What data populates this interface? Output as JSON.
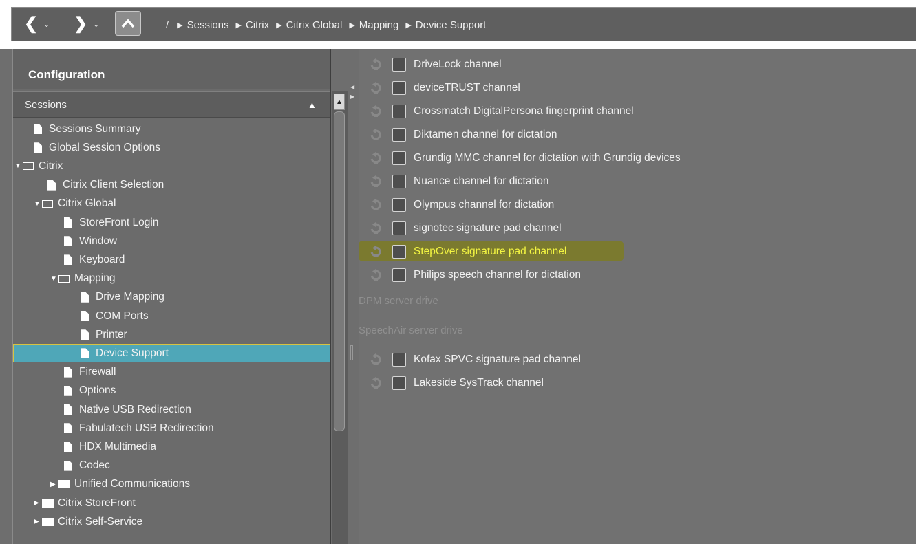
{
  "toolbar": {
    "back_icon": "chevron-left-icon",
    "forward_icon": "chevron-right-icon",
    "dropdown_icon": "caret-down-icon",
    "up_icon": "chevron-up-icon",
    "breadcrumb": {
      "root": "/",
      "items": [
        "Sessions",
        "Citrix",
        "Citrix Global",
        "Mapping",
        "Device Support"
      ]
    }
  },
  "sidebar": {
    "title": "Configuration",
    "section": "Sessions",
    "tree": [
      {
        "label": "Sessions Summary",
        "type": "file"
      },
      {
        "label": "Global Session Options",
        "type": "file"
      },
      {
        "label": "Citrix",
        "type": "folder-open"
      },
      {
        "label": "Citrix Client Selection",
        "type": "file"
      },
      {
        "label": "Citrix Global",
        "type": "folder-open"
      },
      {
        "label": "StoreFront Login",
        "type": "file"
      },
      {
        "label": "Window",
        "type": "file"
      },
      {
        "label": "Keyboard",
        "type": "file"
      },
      {
        "label": "Mapping",
        "type": "folder-open"
      },
      {
        "label": "Drive Mapping",
        "type": "file"
      },
      {
        "label": "COM Ports",
        "type": "file"
      },
      {
        "label": "Printer",
        "type": "file"
      },
      {
        "label": "Device Support",
        "type": "file",
        "selected": true
      },
      {
        "label": "Firewall",
        "type": "file"
      },
      {
        "label": "Options",
        "type": "file"
      },
      {
        "label": "Native USB Redirection",
        "type": "file"
      },
      {
        "label": "Fabulatech USB Redirection",
        "type": "file"
      },
      {
        "label": "HDX Multimedia",
        "type": "file"
      },
      {
        "label": "Codec",
        "type": "file"
      },
      {
        "label": "Unified Communications",
        "type": "folder-closed"
      },
      {
        "label": "Citrix StoreFront",
        "type": "folder-closed"
      },
      {
        "label": "Citrix Self-Service",
        "type": "folder-closed"
      }
    ]
  },
  "content": {
    "channels": [
      {
        "label": "DriveLock channel",
        "checked": false
      },
      {
        "label": "deviceTRUST channel",
        "checked": false
      },
      {
        "label": "Crossmatch DigitalPersona fingerprint channel",
        "checked": false
      },
      {
        "label": "Diktamen channel for dictation",
        "checked": false
      },
      {
        "label": "Grundig MMC channel for dictation with Grundig devices",
        "checked": false
      },
      {
        "label": "Nuance channel for dictation",
        "checked": false
      },
      {
        "label": "Olympus channel for dictation",
        "checked": false
      },
      {
        "label": "signotec signature pad channel",
        "checked": false
      },
      {
        "label": "StepOver signature pad channel",
        "checked": false,
        "highlighted": true
      },
      {
        "label": "Philips speech channel for dictation",
        "checked": false
      }
    ],
    "disabled_headings": [
      "DPM server drive",
      "SpeechAir server drive"
    ],
    "channels_2": [
      {
        "label": "Kofax SPVC signature pad channel",
        "checked": false
      },
      {
        "label": "Lakeside SysTrack channel",
        "checked": false
      }
    ]
  },
  "colors": {
    "background": "#6e6e6e",
    "selection": "#4fa7b8",
    "highlight_text": "#f3f542",
    "highlight_mark": "#7b7a2f"
  }
}
